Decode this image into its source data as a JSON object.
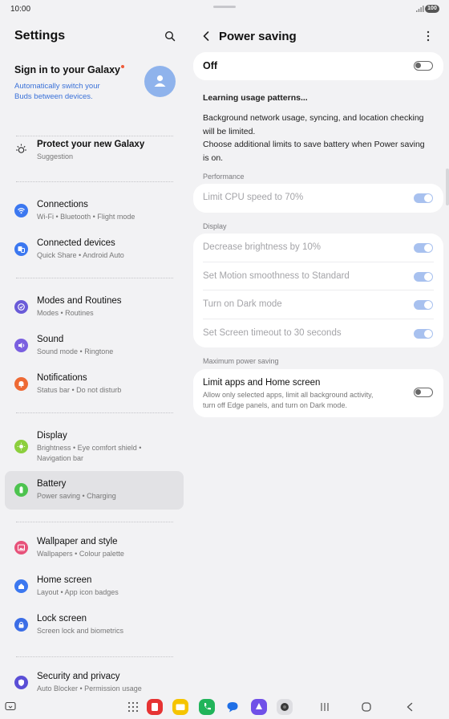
{
  "status_bar": {
    "time": "10:00",
    "battery": "100"
  },
  "settings": {
    "title": "Settings",
    "account": {
      "name": "Sign in to your Galaxy",
      "description": "Automatically switch your Buds between devices."
    },
    "suggestion": {
      "title": "Protect your new Galaxy",
      "sub": "Suggestion"
    },
    "items": [
      {
        "title": "Connections",
        "sub": "Wi-Fi  •  Bluetooth  •  Flight mode",
        "color": "#3c78f0"
      },
      {
        "title": "Connected devices",
        "sub": "Quick Share  •  Android Auto",
        "color": "#3c78f0"
      },
      {
        "title": "Modes and Routines",
        "sub": "Modes  •  Routines",
        "color": "#6a5bd8"
      },
      {
        "title": "Sound",
        "sub": "Sound mode  •  Ringtone",
        "color": "#7a5fe0"
      },
      {
        "title": "Notifications",
        "sub": "Status bar  •  Do not disturb",
        "color": "#ee6a34"
      },
      {
        "title": "Display",
        "sub": "Brightness  •  Eye comfort shield  •",
        "sub2": "Navigation bar",
        "color": "#8ccf3d"
      },
      {
        "title": "Battery",
        "sub": "Power saving  •  Charging",
        "color": "#4dc34f"
      },
      {
        "title": "Wallpaper and style",
        "sub": "Wallpapers  •  Colour palette",
        "color": "#e7527a"
      },
      {
        "title": "Home screen",
        "sub": "Layout  •  App icon badges",
        "color": "#3c78f0"
      },
      {
        "title": "Lock screen",
        "sub": "Screen lock and biometrics",
        "color": "#3c6ee6"
      },
      {
        "title": "Security and privacy",
        "sub": "Auto Blocker  •  Permission usage",
        "color": "#5b4fd6"
      }
    ]
  },
  "power_saving": {
    "title": "Power saving",
    "master": {
      "label": "Off",
      "enabled": false
    },
    "learning": "Learning usage patterns...",
    "description_1": "Background network usage, syncing, and location checking",
    "description_2": "will be limited.",
    "description_3": "Choose additional limits to save battery when Power saving",
    "description_4": "is on.",
    "performance_label": "Performance",
    "performance_items": [
      {
        "label": "Limit CPU speed to 70%",
        "enabled": true
      }
    ],
    "display_label": "Display",
    "display_items": [
      {
        "label": "Decrease brightness by 10%",
        "enabled": true
      },
      {
        "label": "Set Motion smoothness to Standard",
        "enabled": true
      },
      {
        "label": "Turn on Dark mode",
        "enabled": true
      },
      {
        "label": "Set Screen timeout to 30 seconds",
        "enabled": true
      }
    ],
    "max_label": "Maximum power saving",
    "max_item": {
      "label": "Limit apps and Home screen",
      "desc_1": "Allow only selected apps, limit all background activity,",
      "desc_2": "turn off Edge panels, and turn on Dark mode.",
      "enabled": false
    }
  },
  "navbar": {
    "apps": [
      {
        "name": "all-apps",
        "color": "#555555"
      },
      {
        "name": "samsung-notes",
        "color": "#e63333"
      },
      {
        "name": "my-files",
        "color": "#f5c400"
      },
      {
        "name": "phone",
        "color": "#21b45a"
      },
      {
        "name": "messages",
        "color": "#1f6fe6"
      },
      {
        "name": "galaxy-store",
        "color": "#7050e8"
      },
      {
        "name": "camera",
        "color": "#3a3a3a"
      }
    ]
  }
}
